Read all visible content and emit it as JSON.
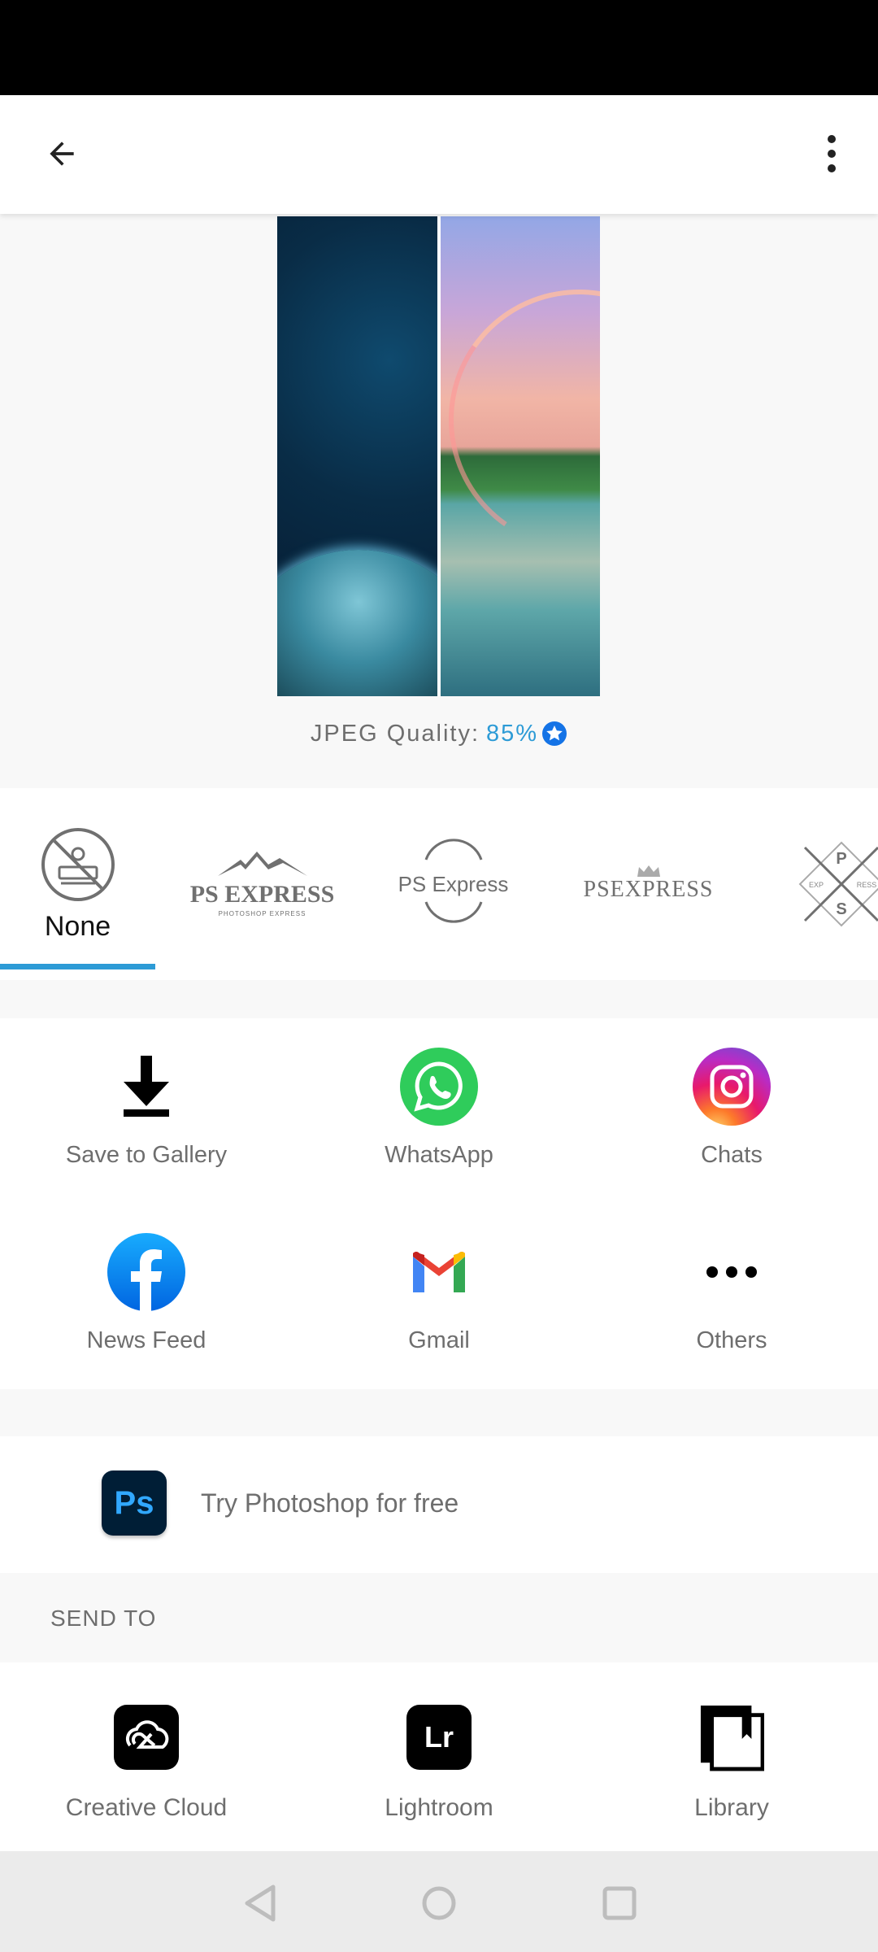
{
  "header": {
    "back_icon": "arrow-left-icon",
    "menu_icon": "more-vertical-icon"
  },
  "preview": {
    "panels": [
      "space-planet-wallpaper",
      "rainbow-lake-photo"
    ]
  },
  "quality": {
    "label": "JPEG Quality:",
    "value": "85%",
    "premium_icon": "star-badge-icon",
    "accent_color": "#2d9bd6"
  },
  "watermarks": {
    "selected_index": 0,
    "items": [
      {
        "label": "None",
        "icon": "no-stamp-icon"
      },
      {
        "title": "PS EXPRESS",
        "subtitle": "PHOTOSHOP EXPRESS"
      },
      {
        "title": "PS Express"
      },
      {
        "title": "PSEXPRESS"
      },
      {
        "letters_top": "P",
        "letters_bottom": "S",
        "left": "EXP",
        "right": "RESS"
      }
    ]
  },
  "share": {
    "items": [
      {
        "label": "Save to Gallery",
        "icon": "download-icon"
      },
      {
        "label": "WhatsApp",
        "icon": "whatsapp-icon"
      },
      {
        "label": "Chats",
        "icon": "instagram-icon"
      },
      {
        "label": "News Feed",
        "icon": "facebook-icon"
      },
      {
        "label": "Gmail",
        "icon": "gmail-icon"
      },
      {
        "label": "Others",
        "icon": "more-horizontal-icon"
      }
    ]
  },
  "promo": {
    "icon_text": "Ps",
    "label": "Try Photoshop for free"
  },
  "send_to": {
    "title": "SEND TO",
    "items": [
      {
        "label": "Creative Cloud",
        "icon": "creative-cloud-icon"
      },
      {
        "label": "Lightroom",
        "icon": "lightroom-icon",
        "icon_text": "Lr"
      },
      {
        "label": "Library",
        "icon": "library-icon"
      }
    ]
  }
}
